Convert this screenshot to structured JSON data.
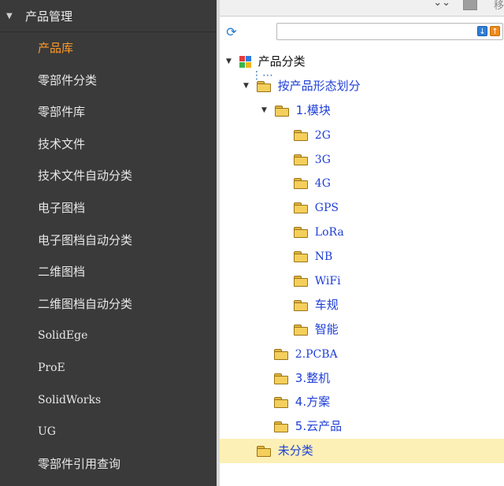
{
  "sidebar": {
    "header": {
      "label": "产品管理"
    },
    "items": [
      {
        "label": "产品库",
        "active": true
      },
      {
        "label": "零部件分类"
      },
      {
        "label": "零部件库"
      },
      {
        "label": "技术文件"
      },
      {
        "label": "技术文件自动分类"
      },
      {
        "label": "电子图档"
      },
      {
        "label": "电子图档自动分类"
      },
      {
        "label": "二维图档"
      },
      {
        "label": "二维图档自动分类"
      },
      {
        "label": "SolidEge"
      },
      {
        "label": "ProE"
      },
      {
        "label": "SolidWorks"
      },
      {
        "label": "UG"
      },
      {
        "label": "零部件引用查询"
      }
    ]
  },
  "topbar": {
    "partial_label": "移"
  },
  "toolbar": {
    "search": {
      "value": "",
      "placeholder": ""
    },
    "icons": [
      "refresh-icon",
      "tree-structure-icon",
      "move-down-icon",
      "move-up-icon"
    ]
  },
  "tree": {
    "root": "产品分类",
    "category_1": "按产品形态划分",
    "group_1": "1.模块",
    "modules": [
      "2G",
      "3G",
      "4G",
      "GPS",
      "LoRa",
      "NB",
      "WiFi",
      "车规",
      "智能"
    ],
    "group_2": "2.PCBA",
    "group_3": "3.整机",
    "group_4": "4.方案",
    "group_5": "5.云产品",
    "uncategorized": "未分类"
  },
  "colors": {
    "sidebar_bg": "#3a3a3a",
    "active_item": "#ff9a2a",
    "tree_text": "#1f3fd6",
    "selected_row": "#fdf0b6"
  }
}
